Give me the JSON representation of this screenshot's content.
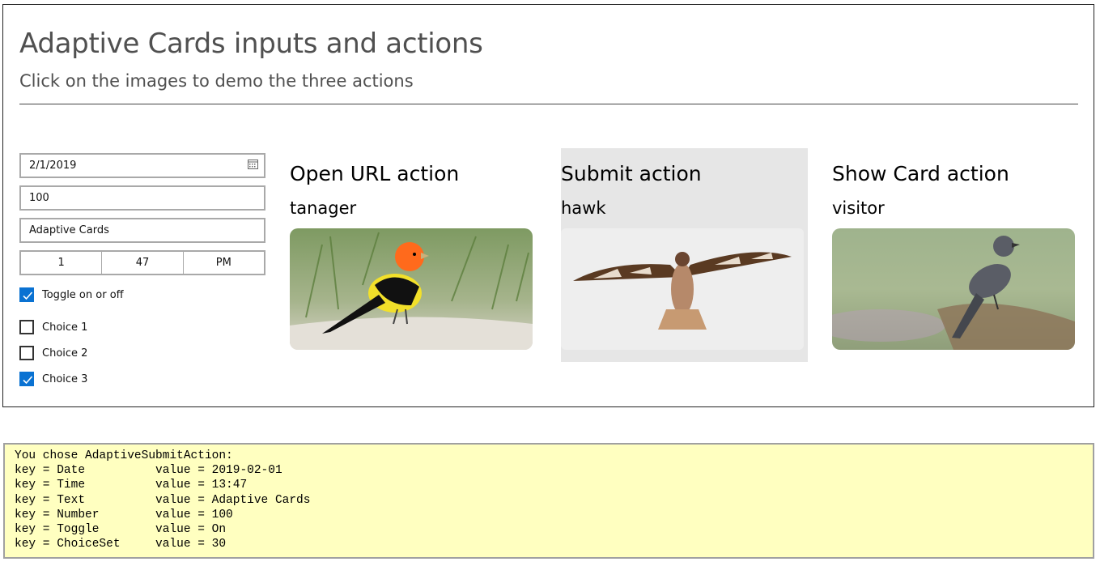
{
  "header": {
    "title": "Adaptive Cards inputs and actions",
    "subtitle": "Click on the images to demo the three actions"
  },
  "inputs": {
    "date": "2/1/2019",
    "number": "100",
    "text": "Adaptive Cards",
    "time": {
      "hour": "1",
      "minute": "47",
      "period": "PM"
    },
    "toggle": {
      "label": "Toggle on or off",
      "checked": true
    },
    "choices": [
      {
        "label": "Choice 1",
        "checked": false
      },
      {
        "label": "Choice 2",
        "checked": false
      },
      {
        "label": "Choice 3",
        "checked": true
      }
    ]
  },
  "actions": [
    {
      "heading": "Open URL action",
      "name": "tanager",
      "icon": "tanager-image"
    },
    {
      "heading": "Submit action",
      "name": "hawk",
      "icon": "hawk-image"
    },
    {
      "heading": "Show Card action",
      "name": "visitor",
      "icon": "visitor-image"
    }
  ],
  "output": {
    "lines": [
      "You chose AdaptiveSubmitAction:",
      "key = Date          value = 2019-02-01",
      "key = Time          value = 13:47",
      "key = Text          value = Adaptive Cards",
      "key = Number        value = 100",
      "key = Toggle        value = On",
      "key = ChoiceSet     value = 30"
    ]
  },
  "colors": {
    "checkbox_accent": "#0a72d2",
    "output_background": "#ffffc0",
    "highlight_background": "#e6e6e6"
  }
}
